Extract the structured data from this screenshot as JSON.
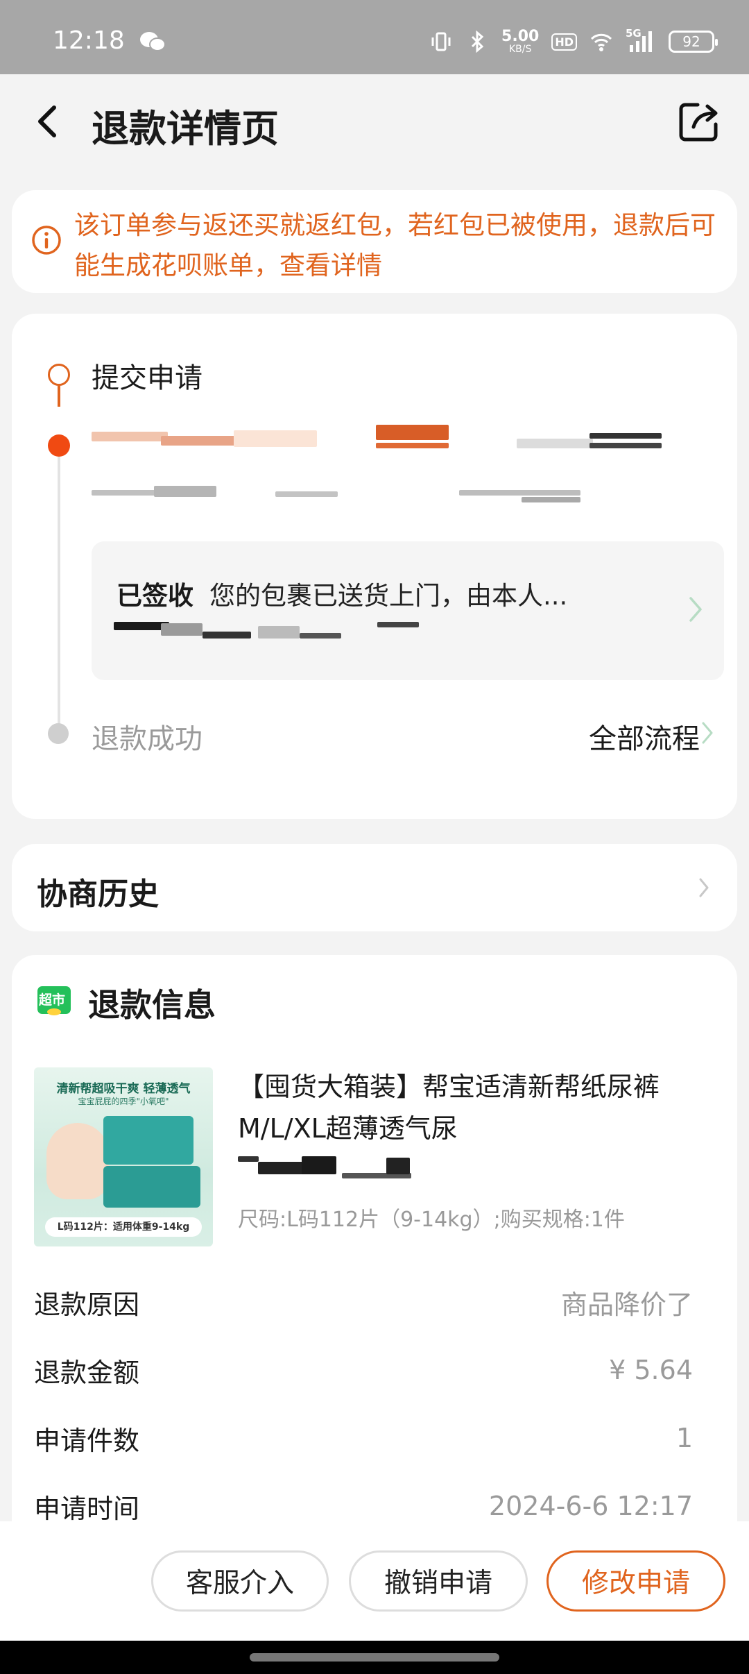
{
  "status_bar": {
    "time": "12:18",
    "net_speed": "5.00",
    "net_unit": "KB/S",
    "hd": "HD",
    "network": "5G",
    "battery": "92"
  },
  "header": {
    "title": "退款详情页"
  },
  "notice": {
    "text": "该订单参与返还买就返红包，若红包已被使用，退款后可能生成花呗账单，查看详情"
  },
  "progress": {
    "step1": "提交申请",
    "package_status": "已签收",
    "package_desc": "您的包裹已送货上门，由本人...",
    "step3": "退款成功",
    "all_flow": "全部流程"
  },
  "history": {
    "label": "协商历史"
  },
  "refund": {
    "badge": "超市",
    "title": "退款信息",
    "product": {
      "name": "【囤货大箱装】帮宝适清新帮纸尿裤M/L/XL超薄透气尿",
      "spec": "尺码:L码112片（9-14kg）;购买规格:1件",
      "img_top": "清新帮超吸干爽 轻薄透气",
      "img_sub": "宝宝屁屁的四季\"小氧吧\"",
      "img_tag": "L码112片：适用体重9-14kg"
    },
    "rows": [
      {
        "k": "退款原因",
        "v": "商品降价了"
      },
      {
        "k": "退款金额",
        "v": "¥ 5.64"
      },
      {
        "k": "申请件数",
        "v": "1"
      },
      {
        "k": "申请时间",
        "v": "2024-6-6 12:17"
      }
    ]
  },
  "actions": {
    "service": "客服介入",
    "cancel": "撤销申请",
    "modify": "修改申请"
  },
  "colors": {
    "accent": "#e0641e",
    "background": "#f3f3f3"
  }
}
